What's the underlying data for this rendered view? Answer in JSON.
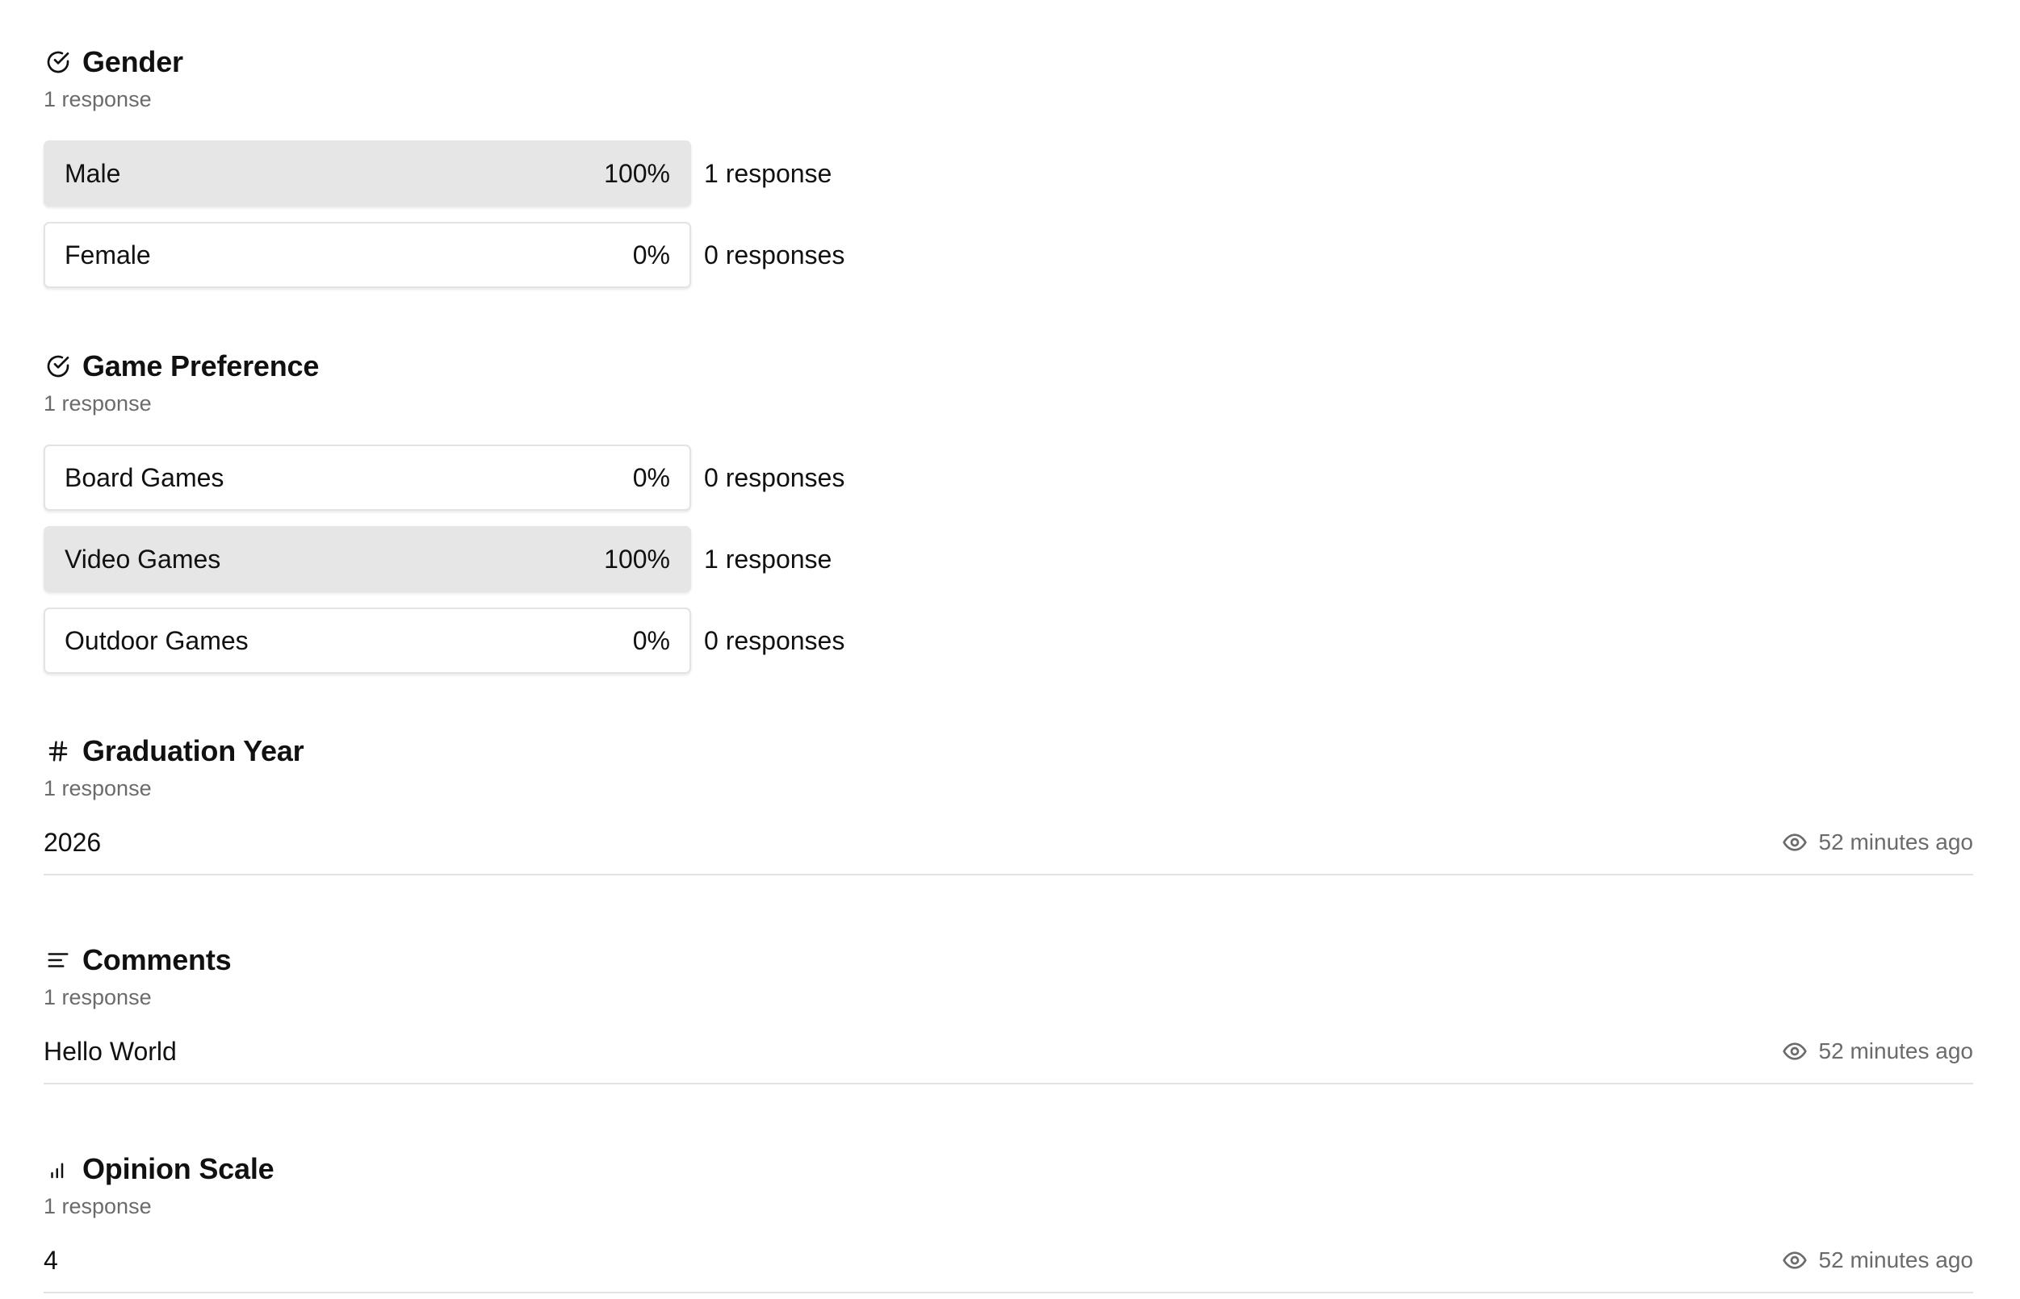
{
  "questions": {
    "gender": {
      "title": "Gender",
      "icon": "check-circle-icon",
      "subtitle": "1 response",
      "options": [
        {
          "label": "Male",
          "percent": "100%",
          "count": "1 response",
          "selected": true
        },
        {
          "label": "Female",
          "percent": "0%",
          "count": "0 responses",
          "selected": false
        }
      ]
    },
    "game_preference": {
      "title": "Game Preference",
      "icon": "check-circle-icon",
      "subtitle": "1 response",
      "options": [
        {
          "label": "Board Games",
          "percent": "0%",
          "count": "0 responses",
          "selected": false
        },
        {
          "label": "Video Games",
          "percent": "100%",
          "count": "1 response",
          "selected": true
        },
        {
          "label": "Outdoor Games",
          "percent": "0%",
          "count": "0 responses",
          "selected": false
        }
      ]
    },
    "graduation_year": {
      "title": "Graduation Year",
      "icon": "hash-icon",
      "subtitle": "1 response",
      "answer": "2026",
      "time": "52 minutes ago"
    },
    "comments": {
      "title": "Comments",
      "icon": "text-lines-icon",
      "subtitle": "1 response",
      "answer": "Hello World",
      "time": "52 minutes ago"
    },
    "opinion_scale": {
      "title": "Opinion Scale",
      "icon": "bar-chart-icon",
      "subtitle": "1 response",
      "answer": "4",
      "time": "52 minutes ago"
    }
  },
  "colors": {
    "selected_bg": "#e6e6e6",
    "border": "#e3e3e3",
    "muted_text": "#6b6b6b"
  }
}
